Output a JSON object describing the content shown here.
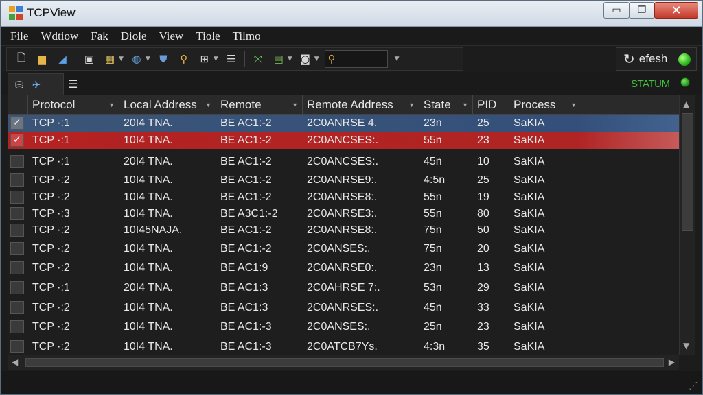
{
  "window": {
    "title": "TCPView",
    "close_glyph": "✕",
    "min_glyph": "▭",
    "max_glyph": "❐"
  },
  "menu": [
    "File",
    "Wdtiow",
    "Fak",
    "Diole",
    "View",
    "Tiole",
    "Tilmo"
  ],
  "toolbar": {
    "icons": [
      "new-file-icon",
      "folder-icon",
      "pen-icon",
      "save-icon",
      "grid-icon",
      "magnify-icon",
      "lock-icon",
      "search-icon",
      "network-icon",
      "list-icon",
      "share-icon",
      "tools-icon",
      "monitor-icon"
    ],
    "search_icon": "search-icon"
  },
  "refresh": {
    "label": "efesh",
    "icon": "refresh-icon"
  },
  "status": {
    "label": "STATUM"
  },
  "columns": [
    "Protocol",
    "Local Address",
    "Remote",
    "Remote Address",
    "State",
    "PID",
    "Process"
  ],
  "rows": [
    {
      "protocol": "TCP ·:1",
      "local": "20I4 TNA.",
      "remote": "BE AC1:-2",
      "raddr": "2C0ANRSE 4.",
      "state": "23n",
      "pid": "25",
      "process": "SaKIA",
      "style": "sel-blue",
      "check": "on"
    },
    {
      "protocol": "TCP ·:1",
      "local": "10I4 TNA.",
      "remote": "BE AC1:-2",
      "raddr": "2C0ANCSES:.",
      "state": "55n",
      "pid": "23",
      "process": "SaKIA",
      "style": "sel-red",
      "check": "red-on"
    },
    {
      "protocol": "TCP ·:1",
      "local": "20I4 TNA.",
      "remote": "BE AC1:-2",
      "raddr": "2C0ANCSES:.",
      "state": "45n",
      "pid": "10",
      "process": "SaKIA",
      "style": "",
      "check": ""
    },
    {
      "protocol": "TCP ·:2",
      "local": "10I4 TNA.",
      "remote": "BE AC1:-2",
      "raddr": "2C0ANRSE9:.",
      "state": "4:5n",
      "pid": "25",
      "process": "SaKIA",
      "style": "",
      "check": ""
    },
    {
      "protocol": "TCP ·:2",
      "local": "10I4 TNA.",
      "remote": "BE AC1:-2",
      "raddr": "2C0ANRSE8:.",
      "state": "55n",
      "pid": "19",
      "process": "SaKIA",
      "style": "",
      "check": ""
    },
    {
      "protocol": "TCP ·:3",
      "local": "10I4 TNA.",
      "remote": "BE A3C1:-2",
      "raddr": "2C0ANRSE3:.",
      "state": "55n",
      "pid": "80",
      "process": "SaKIA",
      "style": "",
      "check": ""
    },
    {
      "protocol": "TCP ·:2",
      "local": "10I45NAJA.",
      "remote": "BE AC1:-2",
      "raddr": "2C0ANRSE8:.",
      "state": "75n",
      "pid": "50",
      "process": "SaKIA",
      "style": "",
      "check": ""
    },
    {
      "protocol": "TCP ·:2",
      "local": "10I4 TNA.",
      "remote": "BE AC1:-2",
      "raddr": "2C0ANSES:.",
      "state": "75n",
      "pid": "20",
      "process": "SaKIA",
      "style": "",
      "check": ""
    },
    {
      "protocol": "TCP ·:2",
      "local": "10I4 TNA.",
      "remote": "BE AC1:9",
      "raddr": "2C0ANRSE0:.",
      "state": "23n",
      "pid": "13",
      "process": "SaKIA",
      "style": "",
      "check": ""
    },
    {
      "protocol": "TCP ·:1",
      "local": "20I4 TNA.",
      "remote": "BE AC1:3",
      "raddr": "2C0AHRSE 7:.",
      "state": "53n",
      "pid": "29",
      "process": "SaKIA",
      "style": "",
      "check": ""
    },
    {
      "protocol": "TCP ·:2",
      "local": "10I4 TNA.",
      "remote": "BE AC1:3",
      "raddr": "2C0ANRSES:.",
      "state": "45n",
      "pid": "33",
      "process": "SaKIA",
      "style": "",
      "check": ""
    },
    {
      "protocol": "TCP ·:2",
      "local": "10I4 TNA.",
      "remote": "BE AC1:-3",
      "raddr": "2C0ANSES:.",
      "state": "25n",
      "pid": "23",
      "process": "SaKIA",
      "style": "",
      "check": ""
    },
    {
      "protocol": "TCP ·:2",
      "local": "10I4 TNA.",
      "remote": "BE AC1:-3",
      "raddr": "2C0ATCB7Ys.",
      "state": "4:3n",
      "pid": "35",
      "process": "SaKIA",
      "style": "",
      "check": ""
    }
  ]
}
